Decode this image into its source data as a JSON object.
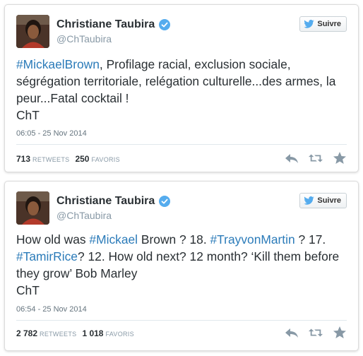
{
  "tweets": [
    {
      "name": "Christiane Taubira",
      "handle": "@ChTaubira",
      "follow_label": "Suivre",
      "text_segments": {
        "t0": "#MickaelBrown",
        "t1": ", Profilage racial, exclusion sociale, ségrégation territoriale, relégation culturelle...des armes, la peur...Fatal cocktail !",
        "t2": "ChT"
      },
      "timestamp": "06:05 - 25 Nov 2014",
      "retweets": "713",
      "retweets_label": "RETWEETS",
      "favorites": "250",
      "favorites_label": "FAVORIS"
    },
    {
      "name": "Christiane Taubira",
      "handle": "@ChTaubira",
      "follow_label": "Suivre",
      "text_segments": {
        "t0": "How old was ",
        "t1": "#Mickael",
        "t2": " Brown ? 18. ",
        "t3": "#TrayvonMartin",
        "t4": " ? 17.",
        "t5": "#TamirRice",
        "t6": "? 12. How old next? 12 month? ‘Kill them before they grow’ Bob Marley",
        "t7": "ChT"
      },
      "timestamp": "06:54 - 25 Nov 2014",
      "retweets": "2 782",
      "retweets_label": "RETWEETS",
      "favorites": "1 018",
      "favorites_label": "FAVORIS"
    }
  ],
  "colors": {
    "hashtag": "#2b7bb9",
    "verified": "#55acee",
    "twitter_blue": "#55acee",
    "action_gray": "#8899a6"
  },
  "icons": {
    "avatar": "profile-photo",
    "verified": "verified-badge-icon",
    "follow_bird": "twitter-bird-icon",
    "reply": "reply-icon",
    "retweet": "retweet-icon",
    "favorite": "star-icon"
  }
}
